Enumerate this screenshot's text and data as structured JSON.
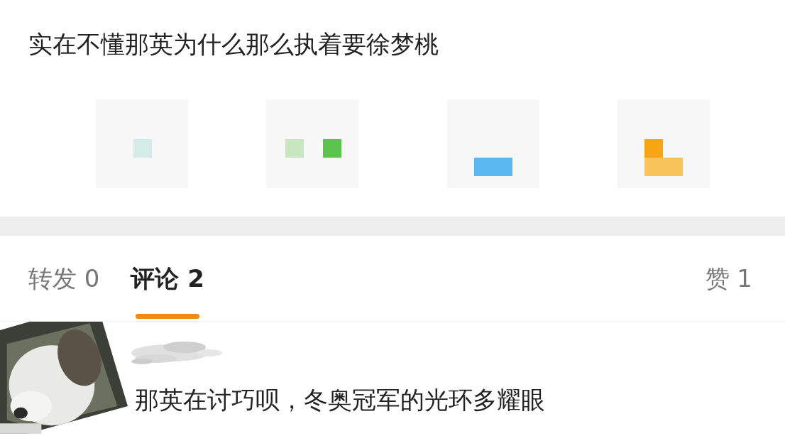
{
  "post": {
    "text": "实在不懂那英为什么那么执着要徐梦桃"
  },
  "tabs": [
    {
      "label": "转发 0",
      "selected": false
    },
    {
      "label": "评论 2",
      "selected": true
    }
  ],
  "likes": {
    "label": "赞 1"
  },
  "comments": [
    {
      "text": "那英在讨巧呗，冬奥冠军的光环多耀眼"
    }
  ]
}
